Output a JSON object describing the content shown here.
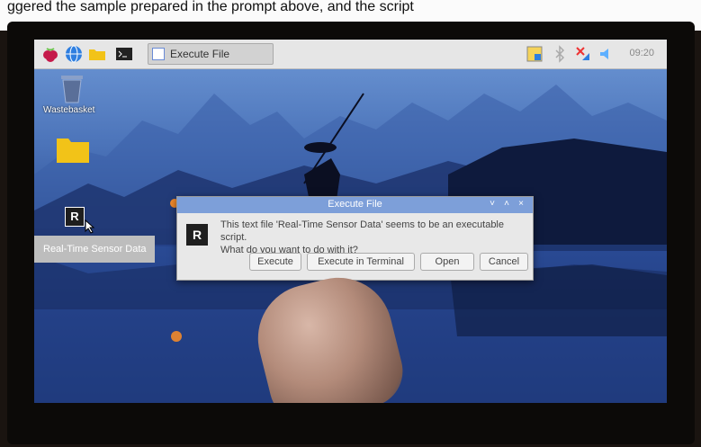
{
  "caption": "ggered the sample prepared in the prompt above, and the script",
  "taskbar": {
    "window_button_label": "Execute File",
    "clock": "09:20",
    "icons": [
      "raspberry-icon",
      "web-browser-icon",
      "file-manager-icon",
      "terminal-icon",
      "window-icon",
      "update-icon",
      "bluetooth-icon",
      "network-disconnected-icon",
      "volume-icon"
    ]
  },
  "desktop": {
    "wastebasket_label": "Wastebasket",
    "tooltip": "Real-Time Sensor Data",
    "script_icon_letter": "R"
  },
  "dialog": {
    "title": "Execute File",
    "icon_letter": "R",
    "message_line1": "This text file 'Real-Time Sensor Data' seems to be an executable script.",
    "message_line2": "What do you want to do with it?",
    "buttons": {
      "execute": "Execute",
      "execute_terminal": "Execute in Terminal",
      "open": "Open",
      "cancel": "Cancel"
    },
    "controls": {
      "minimize": "˅",
      "maximize": "˄",
      "close": "×"
    }
  },
  "colors": {
    "taskbar": "#e6e6e6",
    "dialog_title": "#7d9fd9",
    "desktop_sky": "#4a72b8",
    "folder": "#f2c318"
  }
}
